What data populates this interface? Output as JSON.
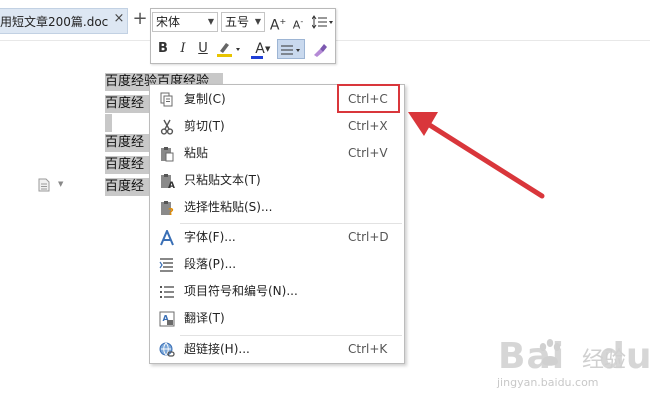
{
  "tab": {
    "title": "用短文章200篇.doc",
    "close_glyph": "×",
    "new_tab_glyph": "+"
  },
  "mini_toolbar": {
    "font_name": "宋体",
    "font_size": "五号",
    "grow_font_label": "A",
    "grow_font_superscript": "+",
    "shrink_font_label": "A",
    "shrink_font_superscript": "-",
    "bold_label": "B",
    "italic_label": "I",
    "underline_label": "U",
    "font_color_label": "A",
    "font_color": "#1f3fd6",
    "highlight_color": "#e8c400"
  },
  "document": {
    "lines": [
      "百度经验百度经验",
      "百度经",
      "",
      "百度经",
      "百度经",
      "百度经"
    ]
  },
  "context_menu": {
    "items": [
      {
        "label": "复制(C)",
        "shortcut": "Ctrl+C",
        "icon": "copy-icon"
      },
      {
        "label": "剪切(T)",
        "shortcut": "Ctrl+X",
        "icon": "scissors-icon"
      },
      {
        "label": "粘贴",
        "shortcut": "Ctrl+V",
        "icon": "paste-icon"
      },
      {
        "label": "只粘贴文本(T)",
        "shortcut": "",
        "icon": "paste-text-icon"
      },
      {
        "label": "选择性粘贴(S)...",
        "shortcut": "",
        "icon": "paste-special-icon"
      },
      {
        "label": "字体(F)...",
        "shortcut": "Ctrl+D",
        "icon": "font-icon"
      },
      {
        "label": "段落(P)...",
        "shortcut": "",
        "icon": "paragraph-icon"
      },
      {
        "label": "项目符号和编号(N)...",
        "shortcut": "",
        "icon": "bullets-icon"
      },
      {
        "label": "翻译(T)",
        "shortcut": "",
        "icon": "translate-icon"
      },
      {
        "label": "超链接(H)...",
        "shortcut": "Ctrl+K",
        "icon": "hyperlink-icon"
      }
    ]
  },
  "annotation": {
    "highlight_color": "#d9363b"
  },
  "watermark": {
    "brand": "Bai",
    "brand_suffix": "du",
    "cn_text": "经验",
    "url": "jingyan.baidu.com"
  }
}
